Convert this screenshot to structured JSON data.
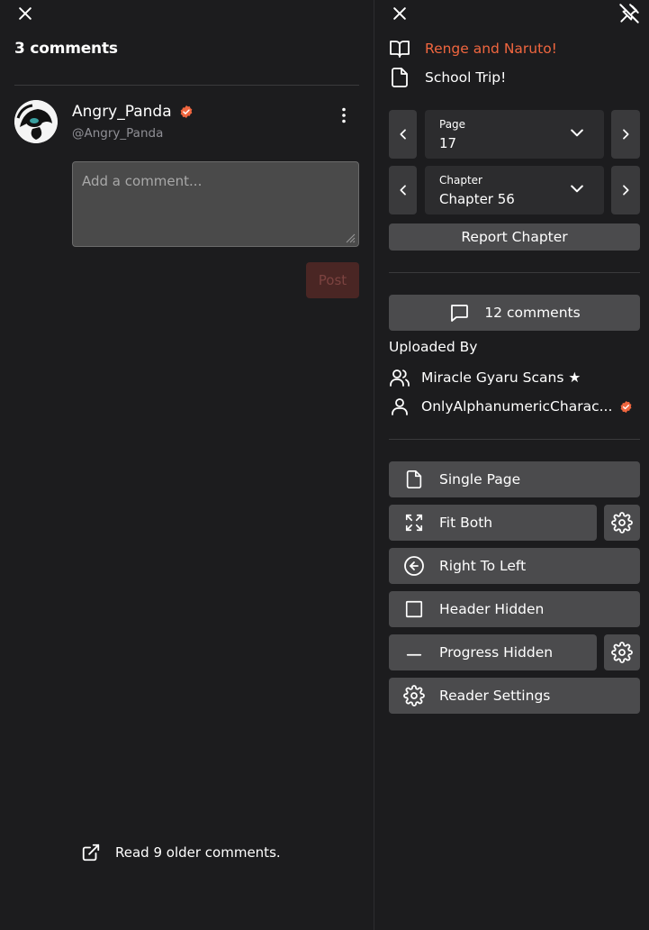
{
  "left": {
    "comments_title": "3 comments",
    "user": {
      "name": "Angry_Panda",
      "handle": "@Angry_Panda"
    },
    "comment_input": {
      "placeholder": "Add a comment...",
      "value": ""
    },
    "post_label": "Post",
    "older_link": "Read 9 older comments."
  },
  "right": {
    "manga_title": "Renge and Naruto!",
    "chapter_name": "School Trip!",
    "page_select": {
      "label": "Page",
      "value": "17"
    },
    "chapter_select": {
      "label": "Chapter",
      "value": "Chapter 56"
    },
    "report_label": "Report Chapter",
    "comments_label": "12 comments",
    "uploaded_by_title": "Uploaded By",
    "group_name": "Miracle Gyaru Scans ★",
    "uploader_name": "OnlyAlphanumericCharac...",
    "settings": {
      "page_mode": "Single Page",
      "fit_mode": "Fit Both",
      "direction": "Right To Left",
      "header": "Header Hidden",
      "progress": "Progress Hidden",
      "reader_settings": "Reader Settings"
    }
  },
  "colors": {
    "accent": "#f0663f",
    "background": "#1c1c1e",
    "button": "#4b4b4d",
    "select": "#2c2c2e",
    "muted_text": "#8f8f95",
    "post_disabled_bg": "#4a2624"
  },
  "icons": [
    "close-icon",
    "unpin-icon",
    "book-icon",
    "file-icon",
    "chevron-left-icon",
    "chevron-right-icon",
    "chevron-down-icon",
    "comment-bubble-icon",
    "users-icon",
    "user-icon",
    "verified-icon",
    "expand-icon",
    "arrow-left-circle-icon",
    "square-icon",
    "minus-icon",
    "gear-icon",
    "external-link-icon",
    "kebab-icon"
  ]
}
